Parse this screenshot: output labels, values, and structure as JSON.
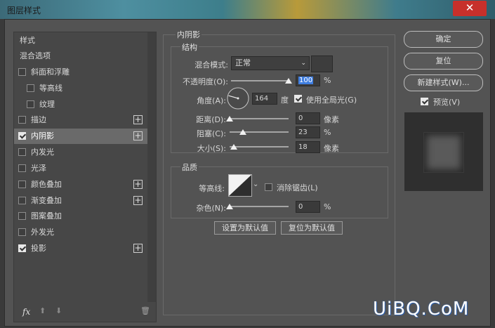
{
  "window": {
    "title": "图层样式",
    "close_glyph": "✕"
  },
  "sidebar": {
    "header": "样式",
    "blend_options": "混合选项",
    "items": [
      {
        "label": "斜面和浮雕",
        "checked": false
      },
      {
        "label": "等高线",
        "checked": false
      },
      {
        "label": "纹理",
        "checked": false
      },
      {
        "label": "描边",
        "checked": false
      },
      {
        "label": "内阴影",
        "checked": true
      },
      {
        "label": "内发光",
        "checked": false
      },
      {
        "label": "光泽",
        "checked": false
      },
      {
        "label": "颜色叠加",
        "checked": false
      },
      {
        "label": "渐变叠加",
        "checked": false
      },
      {
        "label": "图案叠加",
        "checked": false
      },
      {
        "label": "外发光",
        "checked": false
      },
      {
        "label": "投影",
        "checked": true
      }
    ],
    "footer": {
      "fx": "fx",
      "up": "⬆",
      "down": "⬇",
      "trash": "🗑"
    }
  },
  "panel": {
    "title": "内阴影",
    "structure": {
      "title": "结构",
      "blend_mode_label": "混合模式:",
      "blend_mode_value": "正常",
      "opacity_label": "不透明度(O):",
      "opacity_value": "100",
      "opacity_unit": "%",
      "opacity_level": 100,
      "angle_label": "角度(A):",
      "angle_value": "164",
      "angle_unit": "度",
      "global_light_label": "使用全局光(G)",
      "global_light_checked": true,
      "distance_label": "距离(D):",
      "distance_value": "0",
      "distance_unit": "像素",
      "distance_level": 0,
      "choke_label": "阻塞(C):",
      "choke_value": "23",
      "choke_unit": "%",
      "choke_level": 23,
      "size_label": "大小(S):",
      "size_value": "18",
      "size_unit": "像素",
      "size_level": 7
    },
    "quality": {
      "title": "品质",
      "contour_label": "等高线:",
      "anti_alias_label": "消除锯齿(L)",
      "anti_alias_checked": false,
      "noise_label": "杂色(N):",
      "noise_value": "0",
      "noise_unit": "%",
      "noise_level": 0
    },
    "set_default": "设置为默认值",
    "reset_default": "复位为默认值"
  },
  "actions": {
    "ok": "确定",
    "reset": "复位",
    "new_style": "新建样式(W)...",
    "preview_label": "预览(V)",
    "preview_checked": true
  },
  "watermark": "UiBQ.CoM"
}
